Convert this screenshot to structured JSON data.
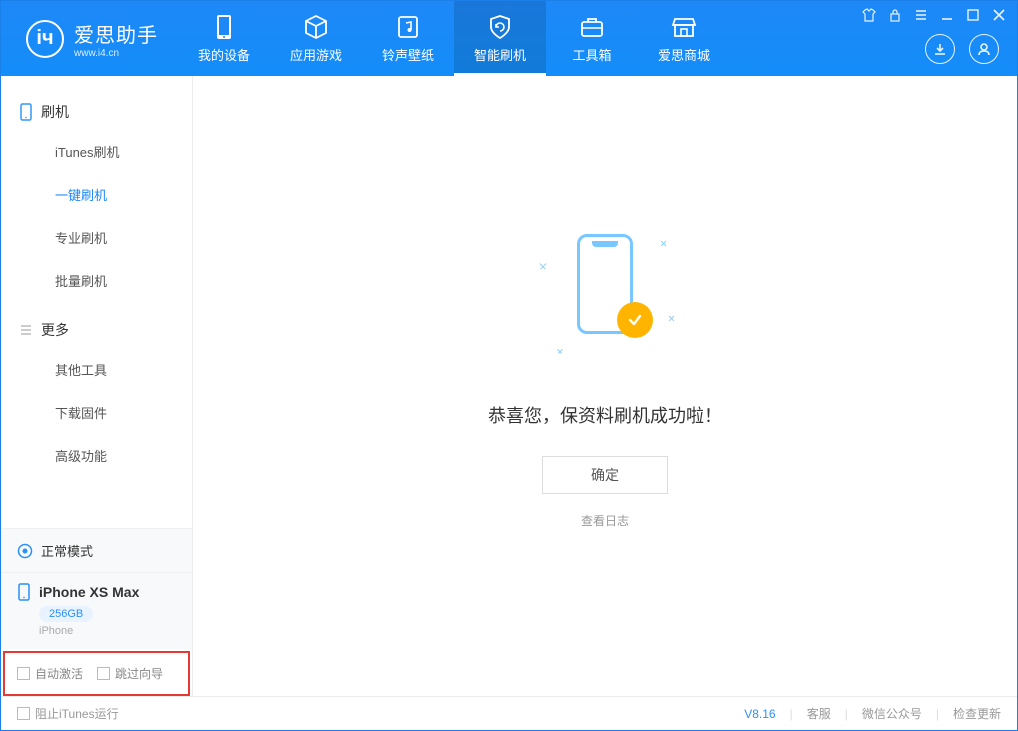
{
  "app": {
    "name_cn": "爱思助手",
    "name_en": "www.i4.cn"
  },
  "top_tabs": [
    {
      "id": "device",
      "label": "我的设备"
    },
    {
      "id": "apps",
      "label": "应用游戏"
    },
    {
      "id": "ringtone",
      "label": "铃声壁纸"
    },
    {
      "id": "flash",
      "label": "智能刷机",
      "active": true
    },
    {
      "id": "tools",
      "label": "工具箱"
    },
    {
      "id": "store",
      "label": "爱思商城"
    }
  ],
  "sidebar": {
    "section1": {
      "title": "刷机",
      "items": [
        {
          "id": "itunes",
          "label": "iTunes刷机"
        },
        {
          "id": "onekey",
          "label": "一键刷机",
          "active": true
        },
        {
          "id": "pro",
          "label": "专业刷机"
        },
        {
          "id": "batch",
          "label": "批量刷机"
        }
      ]
    },
    "section2": {
      "title": "更多",
      "items": [
        {
          "id": "other",
          "label": "其他工具"
        },
        {
          "id": "firmware",
          "label": "下载固件"
        },
        {
          "id": "advanced",
          "label": "高级功能"
        }
      ]
    },
    "status_mode": "正常模式",
    "device": {
      "name": "iPhone XS Max",
      "storage": "256GB",
      "type": "iPhone"
    },
    "checkboxes": {
      "auto_activate": "自动激活",
      "skip_wizard": "跳过向导"
    }
  },
  "main": {
    "success_title": "恭喜您，保资料刷机成功啦！",
    "ok_button": "确定",
    "view_log": "查看日志"
  },
  "statusbar": {
    "block_itunes": "阻止iTunes运行",
    "version": "V8.16",
    "links": {
      "service": "客服",
      "wechat": "微信公众号",
      "update": "检查更新"
    }
  }
}
